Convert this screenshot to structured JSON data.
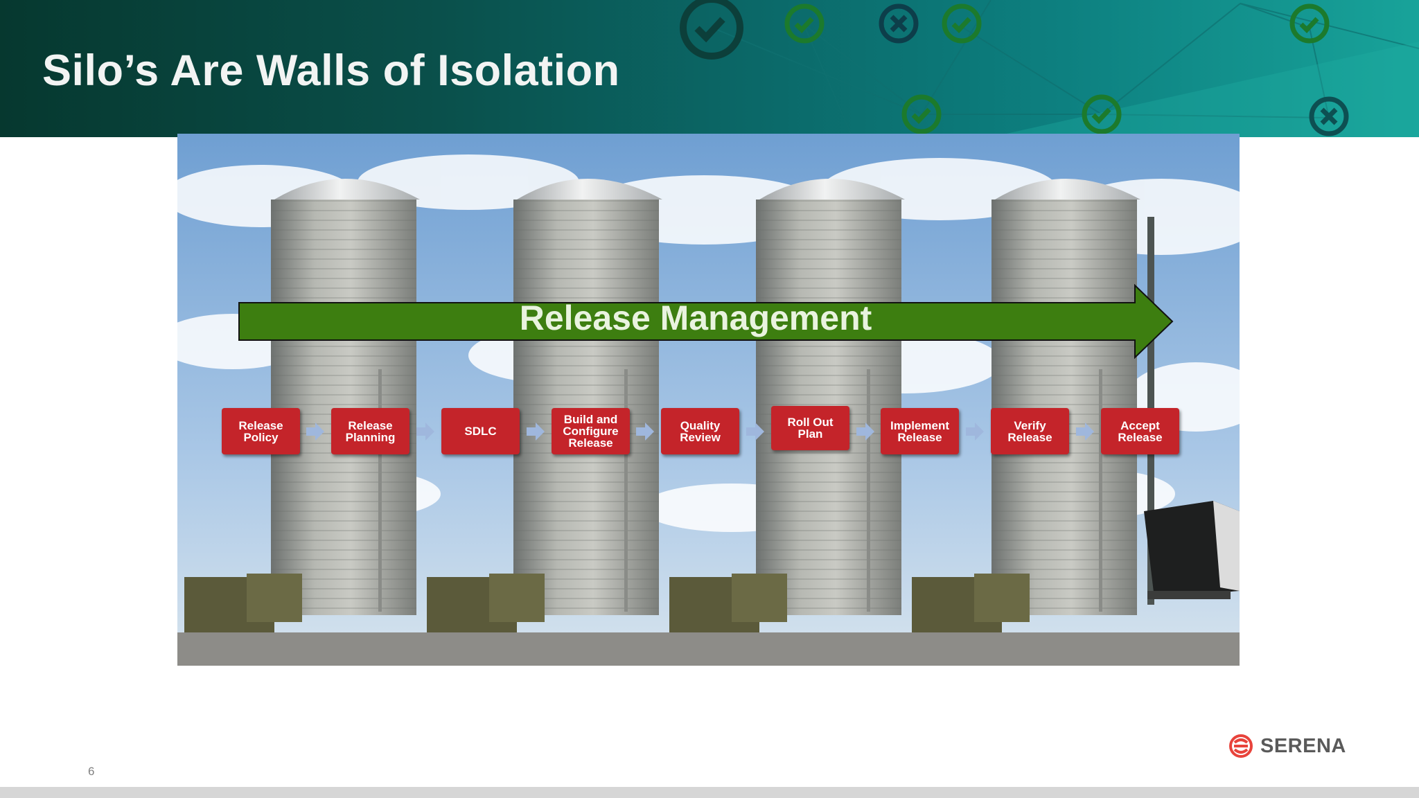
{
  "slide": {
    "title": "Silo’s Are Walls of Isolation",
    "page_number": "6"
  },
  "diagram": {
    "banner_label": "Release Management",
    "banner_color": "#3d7e10",
    "step_color": "#c4242a",
    "connector_color": "#9fb7dd",
    "steps": [
      "Release\nPolicy",
      "Release\nPlanning",
      "SDLC",
      "Build and\nConfigure\nRelease",
      "Quality\nReview",
      "Roll Out\nPlan",
      "Implement\nRelease",
      "Verify\nRelease",
      "Accept\nRelease"
    ]
  },
  "header_icons": [
    "check-circle-icon",
    "check-circle-icon",
    "x-circle-icon",
    "check-circle-icon",
    "check-circle-icon",
    "check-circle-icon",
    "check-circle-icon",
    "x-circle-icon"
  ],
  "logo": {
    "text": "SERENA",
    "color": "#e8433b"
  }
}
